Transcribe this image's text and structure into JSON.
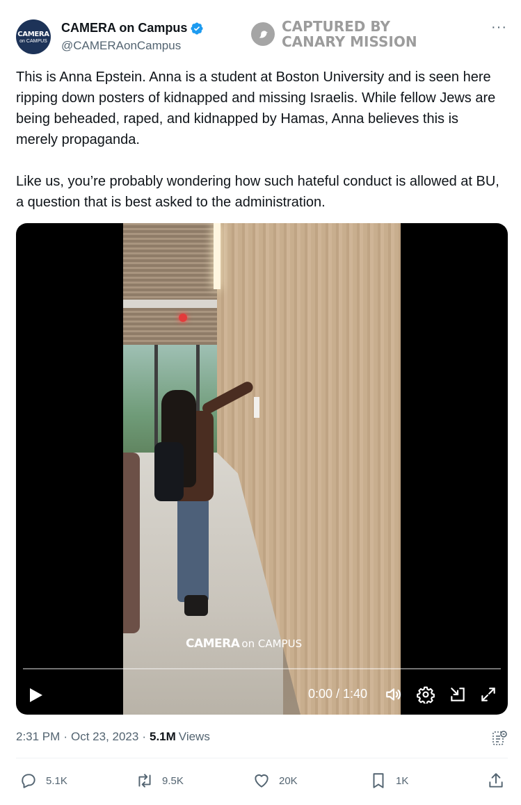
{
  "author": {
    "avatar_line1": "CAMERA",
    "avatar_line2": "on CAMPUS",
    "display_name": "CAMERA on Campus",
    "handle": "@CAMERAonCampus",
    "verified": true
  },
  "watermark": {
    "line1": "CAPTURED BY",
    "line2": "CANARY MISSION"
  },
  "more_label": "···",
  "tweet": {
    "paragraph1": "This is Anna Epstein. Anna is a student at Boston University and is seen here ripping down posters of kidnapped and missing Israelis. While fellow Jews are being beheaded, raped, and kidnapped by Hamas, Anna believes this is merely propaganda.",
    "paragraph2": "Like us, you’re probably wondering how such hateful conduct is allowed at BU, a question that is best asked to the administration."
  },
  "video": {
    "overlay_logo_bold": "CAMERA",
    "overlay_logo_light": "on CAMPUS",
    "time_display": "0:00 / 1:40",
    "progress": 0,
    "controls": [
      "play-icon",
      "volume-icon",
      "settings-icon",
      "pip-icon",
      "fullscreen-icon"
    ]
  },
  "meta": {
    "time": "2:31 PM",
    "date": "Oct 23, 2023",
    "views_count": "5.1M",
    "views_label": "Views",
    "separator": "·"
  },
  "actions": {
    "replies": "5.1K",
    "reposts": "9.5K",
    "likes": "20K",
    "bookmarks": "1K"
  },
  "colors": {
    "text_primary": "#0f1419",
    "text_secondary": "#536471",
    "verified_blue": "#1d9bf0",
    "avatar_bg": "#1d3358"
  }
}
